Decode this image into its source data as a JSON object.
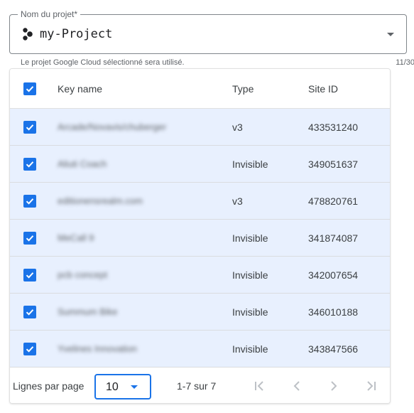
{
  "project": {
    "label": "Nom du projet*",
    "value": "my-Project",
    "hint": "Le projet Google Cloud sélectionné sera utilisé.",
    "char_count": "11/30"
  },
  "table": {
    "headers": {
      "key_name": "Key name",
      "type": "Type",
      "site_id": "Site ID"
    },
    "rows": [
      {
        "key_name": "Arcade/Novavis/chuberger",
        "type": "v3",
        "site_id": "433531240"
      },
      {
        "key_name": "Aliuti Coach",
        "type": "Invisible",
        "site_id": "349051637"
      },
      {
        "key_name": "editionensrealm.com",
        "type": "v3",
        "site_id": "478820761"
      },
      {
        "key_name": "MeCall 9",
        "type": "Invisible",
        "site_id": "341874087"
      },
      {
        "key_name": "pcb concept",
        "type": "Invisible",
        "site_id": "342007654"
      },
      {
        "key_name": "Summum Bike",
        "type": "Invisible",
        "site_id": "346010188"
      },
      {
        "key_name": "Yvelines Innovation",
        "type": "Invisible",
        "site_id": "343847566"
      }
    ]
  },
  "pagination": {
    "rows_per_page_label": "Lignes par page",
    "rows_per_page_value": "10",
    "range": "1-7 sur 7"
  },
  "colors": {
    "accent": "#1a73e8",
    "selected_row": "#e8f0fe",
    "disabled_icon": "#bdc1c6"
  }
}
